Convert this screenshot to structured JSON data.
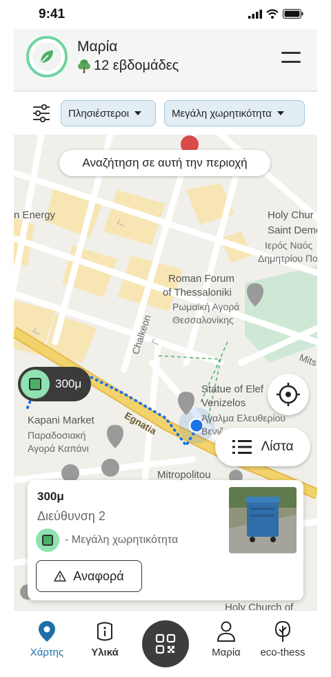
{
  "status_bar": {
    "time": "9:41"
  },
  "header": {
    "user_name": "Μαρία",
    "weeks": "12 εβδομάδες",
    "icons": {
      "avatar": "leaf-icon",
      "weeks": "tree-icon",
      "menu": "menu-icon"
    },
    "colors": {
      "avatar_ring": "#6fd3a3",
      "leaf": "#4caf6a"
    }
  },
  "filters": {
    "sort": "Πλησιέστεροι",
    "capacity": "Μεγάλη χωρητικότητα",
    "icon": "sliders-icon"
  },
  "map": {
    "search_here": "Αναζήτηση σε αυτή την περιοχή",
    "labels": {
      "energy": "n Energy",
      "holy_church_1": "Holy Chur",
      "saint_deme": "Saint Deme",
      "ieros_naos": "Ιερός Ναός",
      "dimitriou": "Δημητρίου Πολιού",
      "roman_forum_1": "Roman Forum",
      "roman_forum_2": "of Thessaloniki",
      "romaiki_1": "Ρωμαϊκή Αγορά",
      "romaiki_2": "Θεσσαλονίκης",
      "chalkeon": "Chalkeon",
      "mits": "Mits",
      "statue_1": "Statue of Elef",
      "statue_2": "Venizelos",
      "agalma_1": "Άγαλμα Ελευθερίου",
      "agalma_2": "Βενιζ",
      "kapani_1": "Kapani Market",
      "kapani_2": "Παραδοσιακή",
      "kapani_3": "Αγορά Καπάνι",
      "egnatia": "Egnatia",
      "mitropolitou": "Mitropolitou",
      "holy_church_2": "Holy Church of"
    },
    "distance_pill": "300μ",
    "list_button": "Λίστα",
    "colors": {
      "road_major": "#f2d36b",
      "park": "#cfe8d6",
      "blocks": "#f7e6b4",
      "route": "#1a73e8"
    }
  },
  "card": {
    "distance": "300μ",
    "address": "Διεύθυνση 2",
    "capacity": "- Μεγάλη χωρητικότητα",
    "report": "Αναφορά",
    "report_icon": "warning-icon"
  },
  "nav": {
    "map": "Χάρτης",
    "materials": "Υλικά",
    "profile": "Μαρία",
    "eco": "eco-thess",
    "active_color": "#1d6fa8",
    "icons": [
      "map-pin-icon",
      "info-book-icon",
      "qr-code-icon",
      "user-icon",
      "tree-icon"
    ]
  }
}
